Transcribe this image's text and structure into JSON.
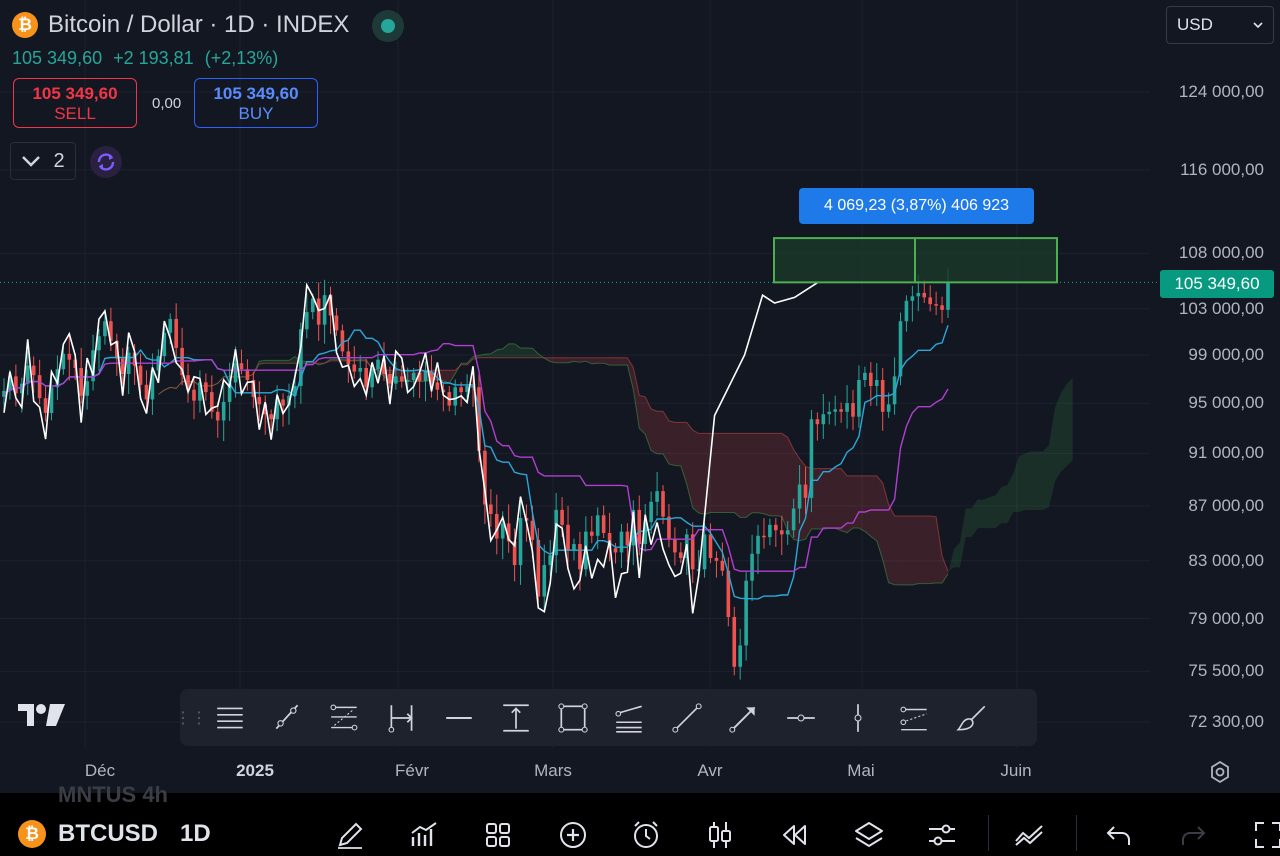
{
  "header": {
    "coin_symbol": "₿",
    "title": "Bitcoin / Dollar · 1D · INDEX",
    "market_status": "open",
    "last_price": "105 349,60",
    "change": "+2 193,81",
    "change_pct": "(+2,13%)"
  },
  "trade": {
    "sell_price": "105 349,60",
    "sell_label": "SELL",
    "spread": "0,00",
    "buy_price": "105 349,60",
    "buy_label": "BUY"
  },
  "legend": {
    "count": "2"
  },
  "currency": {
    "selected": "USD"
  },
  "price_axis": {
    "ticks": [
      "124 000,00",
      "116 000,00",
      "108 000,00",
      "103 000,00",
      "99 000,00",
      "95 000,00",
      "91 000,00",
      "87 000,00",
      "83 000,00",
      "79 000,00",
      "75 500,00",
      "72 300,00"
    ]
  },
  "current_price_tag": "105 349,60",
  "measure_label": "4 069,23 (3,87%) 406 923",
  "time_axis": {
    "labels": [
      "Déc",
      "2025",
      "Févr",
      "Mars",
      "Avr",
      "Mai",
      "Juin"
    ]
  },
  "drawing_toolbar": {
    "tools": [
      "horizontal-lines-icon",
      "trend-line-icon",
      "fib-icon",
      "date-range-icon",
      "horizontal-ray-icon",
      "price-range-icon",
      "rectangle-icon",
      "parallel-channel-icon",
      "line-icon",
      "arrow-icon",
      "horizontal-line-icon",
      "vertical-line-icon",
      "regression-icon",
      "brush-icon"
    ]
  },
  "bottom_bar": {
    "ghost_text": "MNTUS  4h",
    "symbol": "BTCUSD",
    "timeframe": "1D",
    "icons": [
      "pen-icon",
      "indicators-icon",
      "layouts-icon",
      "add-icon",
      "alert-icon",
      "candles-icon",
      "replay-icon",
      "layers-icon",
      "settings-icon",
      "compare-icon",
      "undo-icon",
      "redo-icon",
      "fullscreen-icon"
    ]
  },
  "colors": {
    "background": "#131722",
    "up": "#26a69a",
    "down": "#ef5350",
    "tenkan": "#2ba8d8",
    "kijun": "#b03fd0",
    "overlay_line": "#ffffff",
    "measure_fill": "#1b3a2a",
    "measure_border": "#4caf50"
  },
  "chart_data": {
    "type": "candlestick",
    "symbol": "BTCUSD",
    "interval": "1D",
    "y_axis": {
      "scale": "log",
      "ylim": [
        70500,
        128000
      ]
    },
    "last_price": 105349.6,
    "measure": {
      "low": 105349.6,
      "high": 109418.83,
      "change": 4069.23,
      "change_pct": 3.87
    },
    "closes": [
      96000,
      97200,
      95800,
      96600,
      98100,
      97300,
      95400,
      94200,
      96300,
      97800,
      99100,
      98600,
      97900,
      95600,
      96800,
      99400,
      100600,
      101900,
      100200,
      98700,
      97400,
      99200,
      98100,
      96500,
      95300,
      97700,
      98900,
      100900,
      102100,
      99600,
      97300,
      96100,
      95200,
      96700,
      95900,
      94300,
      93600,
      95100,
      96700,
      98300,
      97800,
      96900,
      95500,
      94900,
      94100,
      93700,
      95300,
      94800,
      95600,
      96400,
      101200,
      102700,
      103900,
      101600,
      104200,
      102400,
      101100,
      99300,
      98200,
      97600,
      97900,
      96300,
      97800,
      98600,
      97400,
      96600,
      97200,
      96800,
      96900,
      97500,
      96800,
      97600,
      96700,
      96100,
      95900,
      94800,
      96300,
      95900,
      96400,
      96300,
      91200,
      87100,
      86400,
      84600,
      85700,
      84400,
      82700,
      86100,
      85900,
      84500,
      80500,
      82700,
      83400,
      86700,
      85600,
      83800,
      84200,
      82400,
      85100,
      84800,
      86300,
      85000,
      83900,
      83600,
      85100,
      84100,
      86700,
      84200,
      85800,
      87300,
      88100,
      86200,
      84600,
      83600,
      83200,
      84900,
      82400,
      82400,
      84900,
      83200,
      83000,
      82300,
      79100,
      75800,
      77200,
      81600,
      83500,
      84800,
      84700,
      85600,
      85200,
      84900,
      85200,
      86800,
      88600,
      87600,
      93700,
      93300,
      94100,
      94300,
      94500,
      94300,
      95000,
      93900,
      96900,
      97500,
      96400,
      96900,
      94300,
      94900,
      97200,
      101900,
      103700,
      104100,
      104400,
      104000,
      103400,
      103300,
      102900,
      105349.6
    ],
    "indicators": [
      "Ichimoku Cloud (Tenkan, Kijun, Senkou A/B)",
      "Compared symbol overlay"
    ],
    "x_labels": [
      "Déc",
      "2025",
      "Févr",
      "Mars",
      "Avr",
      "Mai",
      "Juin"
    ]
  }
}
